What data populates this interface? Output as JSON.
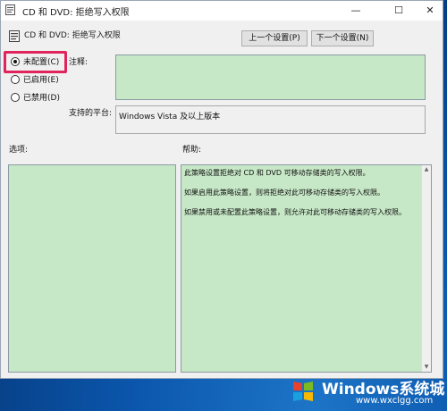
{
  "window": {
    "title": "CD 和 DVD: 拒绝写入权限"
  },
  "window_controls": {
    "minimize": "—",
    "maximize": "☐",
    "close": "✕"
  },
  "header": {
    "policy_title": "CD 和 DVD: 拒绝写入权限"
  },
  "nav": {
    "prev_label": "上一个设置(P)",
    "next_label": "下一个设置(N)"
  },
  "radios": [
    {
      "label": "未配置(C)",
      "checked": true
    },
    {
      "label": "已启用(E)",
      "checked": false
    },
    {
      "label": "已禁用(D)",
      "checked": false
    }
  ],
  "comment": {
    "label": "注释:",
    "value": ""
  },
  "platform": {
    "label": "支持的平台:",
    "value": "Windows Vista 及以上版本"
  },
  "options": {
    "label": "选项:"
  },
  "help": {
    "label": "帮助:",
    "paragraphs": [
      "此策略设置拒绝对 CD 和 DVD 可移动存储类的写入权限。",
      "如果启用此策略设置，则将拒绝对此可移动存储类的写入权限。",
      "如果禁用或未配置此策略设置，则允许对此可移动存储类的写入权限。"
    ]
  },
  "watermark": {
    "title": "Windows系统城",
    "url": "www.wxclgg.com"
  },
  "colors": {
    "panel_green": "#c7e8c7",
    "highlight": "#e0245e",
    "desktop": "#0b57ad"
  }
}
